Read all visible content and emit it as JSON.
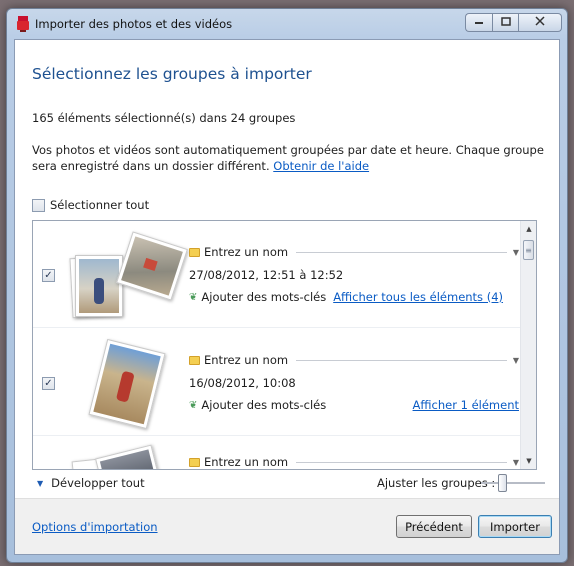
{
  "window": {
    "title": "Importer des photos et des vidéos",
    "icons": {
      "app": "import-app-icon",
      "minimize": "minimize-icon",
      "maximize": "maximize-icon",
      "close": "close-icon"
    }
  },
  "main": {
    "heading": "Sélectionnez les groupes à importer",
    "count": "165 éléments sélectionné(s) dans 24 groupes",
    "description": "Vos photos et vidéos sont automatiquement groupées par date et heure. Chaque groupe sera enregistré dans un dossier différent.",
    "help_link": "Obtenir de l'aide",
    "select_all": "Sélectionner tout"
  },
  "groups": [
    {
      "checked": true,
      "name_placeholder": "Entrez un nom",
      "date": "27/08/2012, 12:51 à 12:52",
      "keywords": "Ajouter des mots-clés",
      "show_link": "Afficher tous les éléments (4)"
    },
    {
      "checked": true,
      "name_placeholder": "Entrez un nom",
      "date": "16/08/2012, 10:08",
      "keywords": "Ajouter des mots-clés",
      "show_link": "Afficher 1 élément"
    },
    {
      "checked": false,
      "name_placeholder": "Entrez un nom",
      "date": "",
      "keywords": "",
      "show_link": ""
    }
  ],
  "controls": {
    "expand_all": "Développer tout",
    "adjust_groups": "Ajuster les groupes :",
    "adjust_level": 0.3
  },
  "footer": {
    "options_link": "Options d'importation",
    "previous": "Précédent",
    "import": "Importer"
  },
  "colors": {
    "heading": "#1e5190",
    "link": "#0a5bc4",
    "title_bar": "#b9cde6"
  }
}
